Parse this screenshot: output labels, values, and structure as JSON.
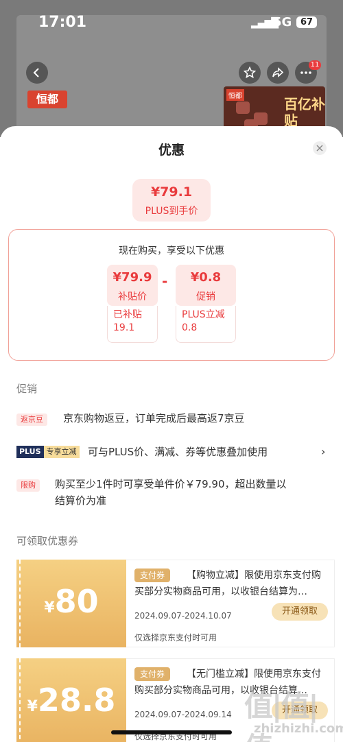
{
  "status_bar": {
    "time": "17:01",
    "network": "5G",
    "battery": "67"
  },
  "background": {
    "badge_count": "11",
    "brand_logo": "恒都",
    "promo_tag": "恒都",
    "promo_text": "百亿补贴"
  },
  "sheet": {
    "title": "优惠",
    "plus_price": {
      "price": "¥79.1",
      "label": "PLUS到手价"
    },
    "deal": {
      "heading": "现在购买，享受以下优惠",
      "items": [
        {
          "value": "¥79.9",
          "label": "补贴价",
          "sub_line1": "已补贴",
          "sub_line2": "19.1"
        },
        {
          "value": "¥0.8",
          "label": "促销",
          "sub_line1": "PLUS立减",
          "sub_line2": "0.8"
        }
      ],
      "operator": "-"
    },
    "promotions": {
      "section_title": "促销",
      "rows": [
        {
          "tag": "返京豆",
          "text": "京东购物返豆，订单完成后最高返7京豆"
        },
        {
          "tag_a": "PLUS",
          "tag_b": "专享立减",
          "text": "可与PLUS价、满减、券等优惠叠加使用"
        },
        {
          "tag": "限购",
          "text_line1": "购买至少1件时可享受单件价￥79.90，超出数量以",
          "text_line2": "结算价为准"
        }
      ]
    },
    "coupons": {
      "section_title": "可领取优惠券",
      "items": [
        {
          "currency": "¥",
          "amount": "80",
          "tag": "支付券",
          "title": "【购物立减】限使用京东支付购买部分实物商品可用，以收银台结算为…",
          "date": "2024.09.07-2024.10.07",
          "note": "仅选择京东支付时可用",
          "button": "开通领取"
        },
        {
          "currency": "¥",
          "amount": "28.8",
          "tag": "支付券",
          "title": "【无门槛立减】限使用京东支付购买部分实物商品可用，以收银台结算…",
          "date": "2024.09.07-2024.09.14",
          "note": "仅选择京东支付时可用",
          "button": "开通领取"
        }
      ]
    }
  },
  "watermark": {
    "big": "值|值|值",
    "small": "zhizhizhi.com"
  },
  "colors": {
    "accent_red": "#e93b3d",
    "coupon_gold": "#e9b361",
    "plus_navy": "#1f2f5a"
  }
}
